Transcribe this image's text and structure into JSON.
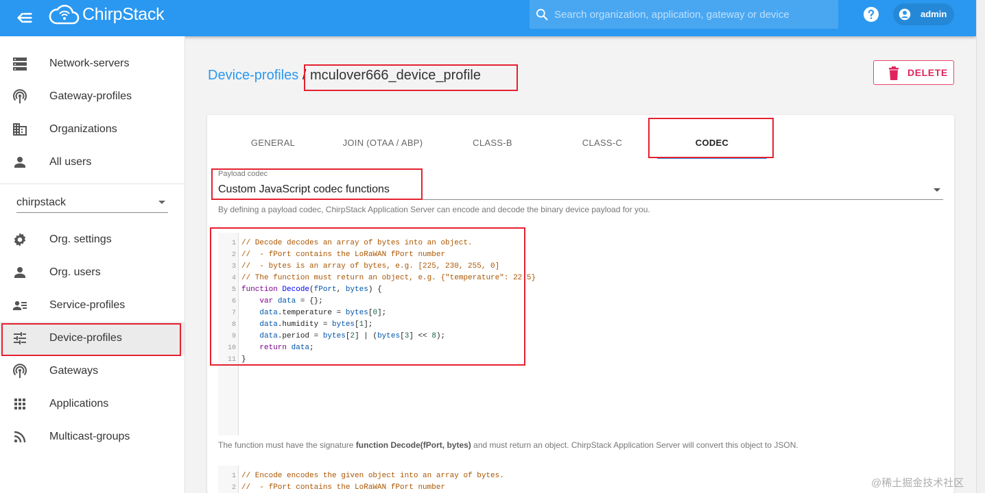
{
  "header": {
    "logo_text": "ChirpStack",
    "search_placeholder": "Search organization, application, gateway or device",
    "user_name": "admin"
  },
  "sidebar": {
    "global_items": [
      {
        "label": "Network-servers",
        "icon": "server-icon"
      },
      {
        "label": "Gateway-profiles",
        "icon": "antenna-icon"
      },
      {
        "label": "Organizations",
        "icon": "domain-icon"
      },
      {
        "label": "All users",
        "icon": "person-icon"
      }
    ],
    "organization": "chirpstack",
    "org_items": [
      {
        "label": "Org. settings",
        "icon": "gear-icon"
      },
      {
        "label": "Org. users",
        "icon": "person-icon"
      },
      {
        "label": "Service-profiles",
        "icon": "account-details-icon"
      },
      {
        "label": "Device-profiles",
        "icon": "tune-icon",
        "active": true
      },
      {
        "label": "Gateways",
        "icon": "antenna-icon"
      },
      {
        "label": "Applications",
        "icon": "apps-grid-icon"
      },
      {
        "label": "Multicast-groups",
        "icon": "rss-icon"
      }
    ]
  },
  "breadcrumb": {
    "parent": "Device-profiles",
    "separator": "/",
    "current": "mculover666_device_profile"
  },
  "delete_label": "DELETE",
  "tabs": [
    "GENERAL",
    "JOIN (OTAA / ABP)",
    "CLASS-B",
    "CLASS-C",
    "CODEC"
  ],
  "active_tab": "CODEC",
  "codec": {
    "field_label": "Payload codec",
    "selected": "Custom JavaScript codec functions",
    "helper": "By defining a payload codec, ChirpStack Application Server can encode and decode the binary device payload for you."
  },
  "decode_code": [
    "// Decode decodes an array of bytes into an object.",
    "//  - fPort contains the LoRaWAN fPort number",
    "//  - bytes is an array of bytes, e.g. [225, 230, 255, 0]",
    "// The function must return an object, e.g. {\"temperature\": 22.5}",
    "function Decode(fPort, bytes) {",
    "    var data = {};",
    "    data.temperature = bytes[0];",
    "    data.humidity = bytes[1];",
    "    data.period = bytes[2] | (bytes[3] << 8);",
    "    return data;",
    "}"
  ],
  "decode_note": {
    "prefix": "The function must have the signature ",
    "signature": "function Decode(fPort, bytes)",
    "suffix": " and must return an object. ChirpStack Application Server will convert this object to JSON."
  },
  "encode_code": [
    "// Encode encodes the given object into an array of bytes.",
    "//  - fPort contains the LoRaWAN fPort number"
  ],
  "watermark": "@稀土掘金技术社区",
  "colors": {
    "appbar": "#2a98f0",
    "link": "#2a98f0",
    "delete": "#e0245e",
    "highlight": "#e5202e"
  }
}
